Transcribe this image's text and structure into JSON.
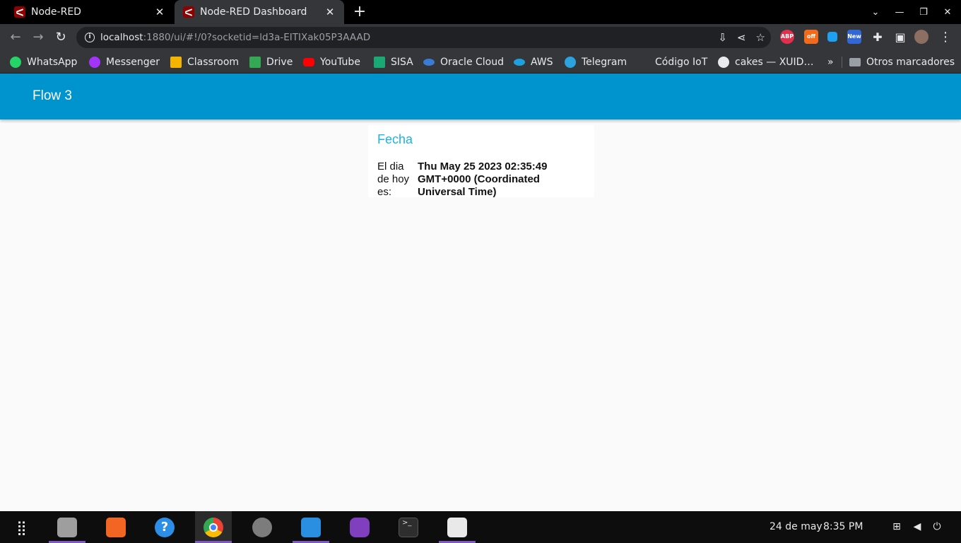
{
  "browser": {
    "tabs": [
      {
        "title": "Node-RED",
        "active": false
      },
      {
        "title": "Node-RED Dashboard",
        "active": true
      }
    ],
    "url": {
      "host": "localhost",
      "rest": ":1880/ui/#!/0?socketid=ld3a-EITIXak05P3AAAD"
    },
    "bookmarks": [
      {
        "label": "WhatsApp",
        "color": "#25d366"
      },
      {
        "label": "Messenger",
        "color": "#a334fa"
      },
      {
        "label": "Classroom",
        "color": "#f4b400"
      },
      {
        "label": "Drive",
        "color": "#34a853"
      },
      {
        "label": "YouTube",
        "color": "#ff0000"
      },
      {
        "label": "SISA",
        "color": "#19a974"
      },
      {
        "label": "Oracle Cloud",
        "color": "#3a7bd5"
      },
      {
        "label": "AWS",
        "color": "#1ea1e0"
      },
      {
        "label": "Telegram",
        "color": "#2aa3df"
      },
      {
        "label": "Código IoT",
        "color": ""
      },
      {
        "label": "cakes — XUID…",
        "color": "#e8eaed"
      }
    ],
    "more_bookmarks": "»",
    "other_bookmarks": "Otros marcadores",
    "extensions": [
      {
        "name": "abp-icon",
        "label": "ABP",
        "color": "#e0304e"
      },
      {
        "name": "off-extension-icon",
        "label": "off",
        "color": "#f26b1d"
      },
      {
        "name": "color-extension-icon",
        "label": "",
        "color": "#1da1f2"
      },
      {
        "name": "new-extension-icon",
        "label": "New",
        "color": "#3367d6"
      }
    ]
  },
  "dashboard": {
    "title": "Flow 3",
    "card": {
      "title": "Fecha",
      "label": "El dia de hoy es:",
      "value": "Thu May 25 2023 02:35:49 GMT+0000 (Coordinated Universal Time)"
    },
    "colors": {
      "header": "#0094ce",
      "card_title": "#1bb3e9"
    }
  },
  "taskbar": {
    "apps": [
      {
        "name": "files-app",
        "color": "#9e9e9e",
        "running": true,
        "focused": false
      },
      {
        "name": "software-center-app",
        "color": "#f26522",
        "running": false,
        "focused": false
      },
      {
        "name": "help-app",
        "color": "#2d8ee8",
        "running": false,
        "focused": false
      },
      {
        "name": "chrome-app",
        "color": "#e94335",
        "running": true,
        "focused": true
      },
      {
        "name": "settings-app",
        "color": "#7c7c7c",
        "running": false,
        "focused": false
      },
      {
        "name": "vscode-app",
        "color": "#2a8fe0",
        "running": true,
        "focused": false
      },
      {
        "name": "github-desktop-app",
        "color": "#7f3fbf",
        "running": false,
        "focused": false
      },
      {
        "name": "terminal-app",
        "color": "#2e2e2e",
        "running": false,
        "focused": false
      },
      {
        "name": "text-editor-app",
        "color": "#e9e9e9",
        "running": true,
        "focused": false
      }
    ],
    "date": "24 de may",
    "time": "8:35 PM"
  }
}
